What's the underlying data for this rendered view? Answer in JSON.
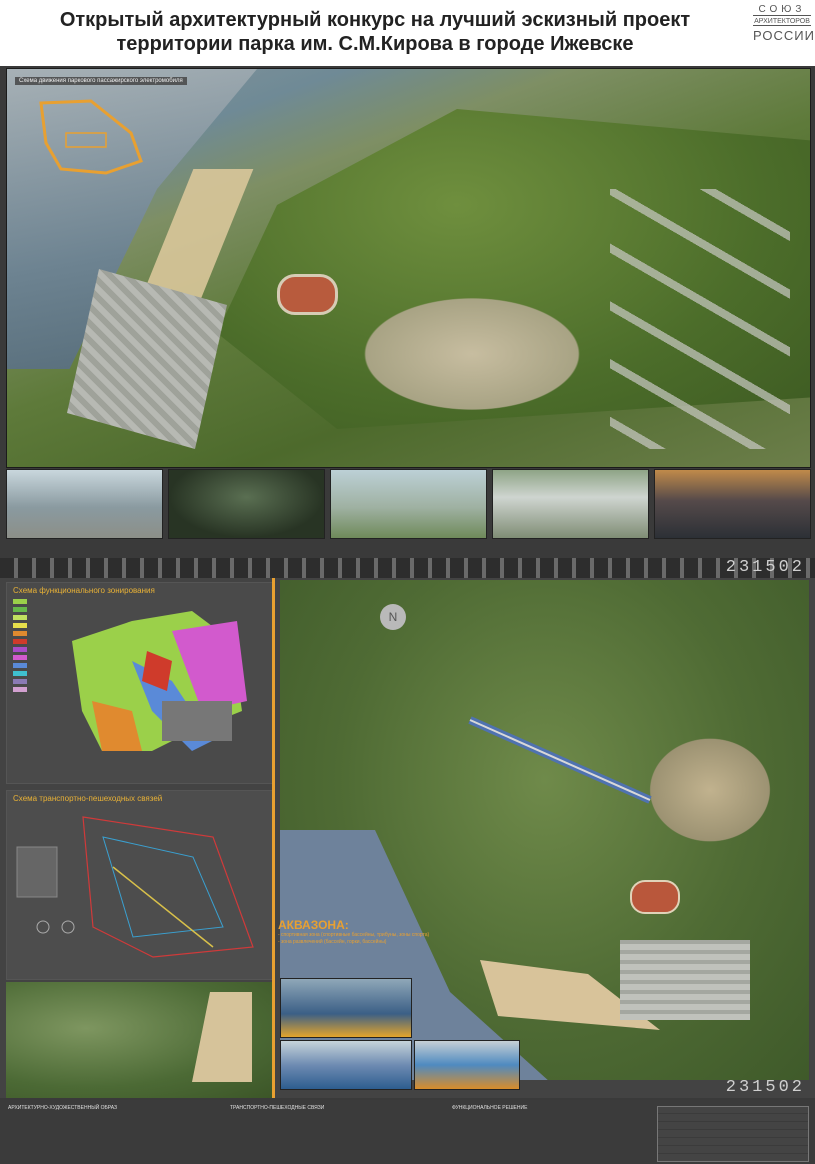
{
  "header": {
    "title": "Открытый архитектурный конкурс на лучший эскизный проект территории парка им. С.М.Кирова в городе Ижевске",
    "logo": {
      "line1": "СОЮЗ",
      "line2": "АРХИТЕКТОРОВ",
      "line3": "РОССИИ"
    }
  },
  "aerial": {
    "route_scheme_label": "Схема движения паркового пассажирского электромобиля"
  },
  "photos": [
    {
      "id": "entrance"
    },
    {
      "id": "cafe-night"
    },
    {
      "id": "attractions"
    },
    {
      "id": "sports-hall"
    },
    {
      "id": "waterfront-night"
    }
  ],
  "code": "231502",
  "zoning": {
    "title": "Схема функционального зонирования"
  },
  "transport": {
    "title": "Схема транспортно-пешеходных связей"
  },
  "compass": "N",
  "aquazone": {
    "title": "АКВАЗОНА:",
    "line1": "- спортивная зона (спортивные бассейны, трибуны, зоны спорта)",
    "line2": "- зона развлечений (бассейн, горки, бассейны)"
  },
  "footer": {
    "col1": "АРХИТЕКТУРНО-ХУДОЖЕСТВЕННЫЙ ОБРАЗ",
    "col2": "ТРАНСПОРТНО-ПЕШЕХОДНЫЕ СВЯЗИ",
    "col3": "ФУНКЦИОНАЛЬНОЕ РЕШЕНИЕ"
  },
  "colors": {
    "accent": "#e8a031",
    "background": "#3a3a3a",
    "header_bg": "#ffffff"
  }
}
